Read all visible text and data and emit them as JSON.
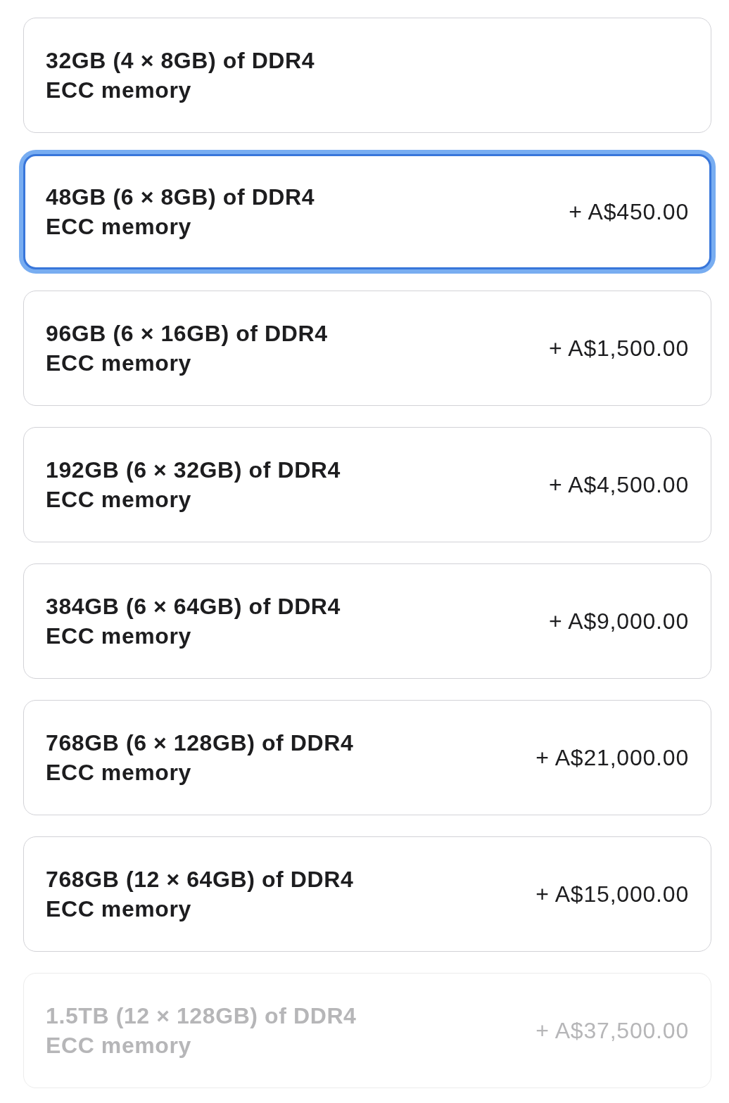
{
  "options": [
    {
      "label": "32GB (4 × 8GB) of DDR4\nECC memory",
      "selected": false,
      "disabled": false
    },
    {
      "label": "48GB (6 × 8GB) of DDR4\nECC memory",
      "price": "+ A$450.00",
      "selected": true,
      "disabled": false
    },
    {
      "label": "96GB (6 × 16GB) of DDR4\nECC memory",
      "price": "+ A$1,500.00",
      "selected": false,
      "disabled": false
    },
    {
      "label": "192GB (6 × 32GB) of DDR4\nECC memory",
      "price": "+ A$4,500.00",
      "selected": false,
      "disabled": false
    },
    {
      "label": "384GB (6 × 64GB) of DDR4\nECC memory",
      "price": "+ A$9,000.00",
      "selected": false,
      "disabled": false
    },
    {
      "label": "768GB (6 × 128GB) of DDR4\nECC memory",
      "price": "+ A$21,000.00",
      "selected": false,
      "disabled": false
    },
    {
      "label": "768GB (12 × 64GB) of DDR4\nECC memory",
      "price": "+ A$15,000.00",
      "selected": false,
      "disabled": false
    },
    {
      "label": "1.5TB (12 × 128GB) of DDR4\nECC memory",
      "price": "+ A$37,500.00",
      "selected": false,
      "disabled": true
    }
  ]
}
